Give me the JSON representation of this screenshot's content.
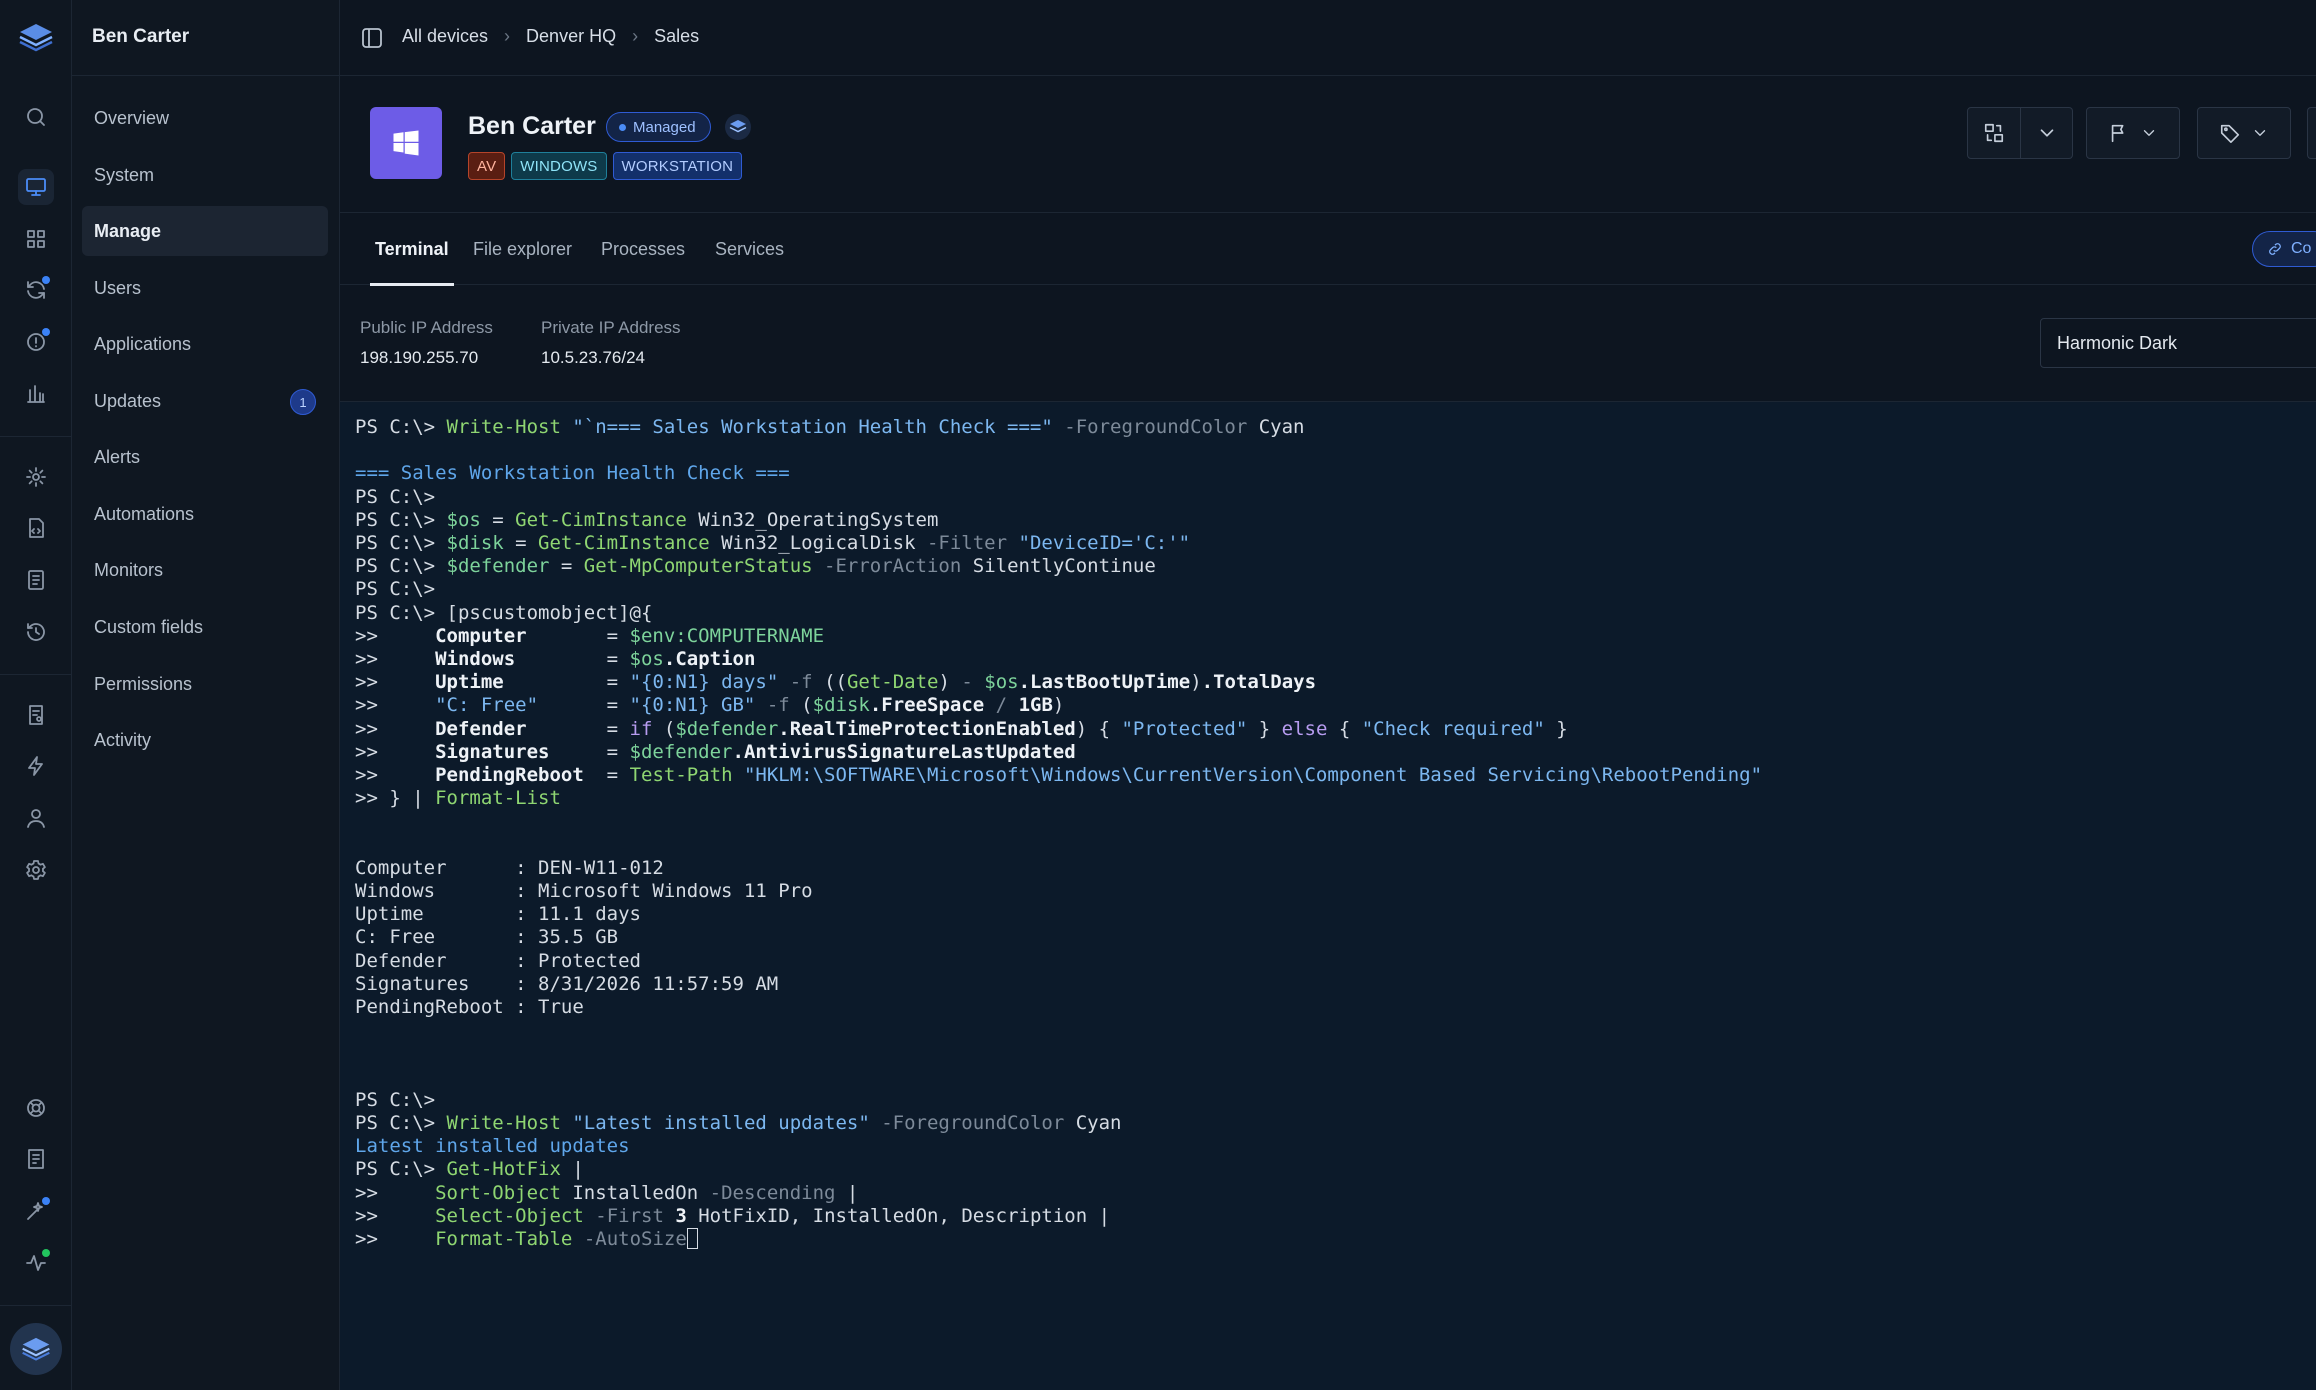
{
  "sidebar": {
    "user_name": "Ben Carter",
    "items": [
      {
        "label": "Overview",
        "badge": ""
      },
      {
        "label": "System",
        "badge": ""
      },
      {
        "label": "Manage",
        "badge": ""
      },
      {
        "label": "Users",
        "badge": ""
      },
      {
        "label": "Applications",
        "badge": ""
      },
      {
        "label": "Updates",
        "badge": "1"
      },
      {
        "label": "Alerts",
        "badge": ""
      },
      {
        "label": "Automations",
        "badge": ""
      },
      {
        "label": "Monitors",
        "badge": ""
      },
      {
        "label": "Custom fields",
        "badge": ""
      },
      {
        "label": "Permissions",
        "badge": ""
      },
      {
        "label": "Activity",
        "badge": ""
      }
    ],
    "active_item": "Manage"
  },
  "rail": {
    "icons": [
      "search-icon",
      "devices-icon",
      "apps-grid-icon",
      "sync-icon",
      "alert-icon",
      "reports-icon",
      "settings-cog-icon",
      "script-icon",
      "document-icon",
      "history-icon",
      "policy-icon",
      "automation-icon",
      "user-icon",
      "settings-icon",
      "support-icon",
      "notes-icon",
      "ai-sparkle-icon",
      "activity-icon"
    ]
  },
  "breadcrumb": {
    "items": [
      "All devices",
      "Denver HQ",
      "Sales"
    ]
  },
  "device": {
    "name": "Ben Carter",
    "status": "Managed",
    "tags": [
      "AV",
      "WINDOWS",
      "WORKSTATION"
    ],
    "os_icon": "windows-icon"
  },
  "tabs": {
    "items": [
      "Terminal",
      "File explorer",
      "Processes",
      "Services"
    ],
    "active": "Terminal",
    "connect_label": "Co"
  },
  "network": {
    "public_label": "Public IP Address",
    "public_value": "198.190.255.70",
    "private_label": "Private IP Address",
    "private_value": "10.5.23.76/24"
  },
  "terminal": {
    "theme": "Harmonic Dark",
    "lines": [
      [
        [
          "t",
          "PS C:\\> "
        ],
        [
          "cmd",
          "Write-Host"
        ],
        [
          "t",
          " "
        ],
        [
          "str",
          "\"`n=== Sales Workstation Health Check ===\""
        ],
        [
          "t",
          " "
        ],
        [
          "param",
          "-ForegroundColor"
        ],
        [
          "t",
          " Cyan"
        ]
      ],
      [],
      [
        [
          "cyan",
          "=== Sales Workstation Health Check ==="
        ]
      ],
      [
        [
          "t",
          "PS C:\\>"
        ]
      ],
      [
        [
          "t",
          "PS C:\\> "
        ],
        [
          "var",
          "$os"
        ],
        [
          "t",
          " = "
        ],
        [
          "cmd",
          "Get-CimInstance"
        ],
        [
          "t",
          " Win32_OperatingSystem"
        ]
      ],
      [
        [
          "t",
          "PS C:\\> "
        ],
        [
          "var",
          "$disk"
        ],
        [
          "t",
          " = "
        ],
        [
          "cmd",
          "Get-CimInstance"
        ],
        [
          "t",
          " Win32_LogicalDisk "
        ],
        [
          "param",
          "-Filter"
        ],
        [
          "t",
          " "
        ],
        [
          "str",
          "\"DeviceID='C:'\""
        ]
      ],
      [
        [
          "t",
          "PS C:\\> "
        ],
        [
          "var",
          "$defender"
        ],
        [
          "t",
          " = "
        ],
        [
          "cmd",
          "Get-MpComputerStatus"
        ],
        [
          "t",
          " "
        ],
        [
          "param",
          "-ErrorAction"
        ],
        [
          "t",
          " SilentlyContinue"
        ]
      ],
      [
        [
          "t",
          "PS C:\\>"
        ]
      ],
      [
        [
          "t",
          "PS C:\\> [pscustomobject]@{"
        ]
      ],
      [
        [
          "t",
          ">>     "
        ],
        [
          "b",
          "Computer"
        ],
        [
          "t",
          "       = "
        ],
        [
          "var",
          "$env:COMPUTERNAME"
        ]
      ],
      [
        [
          "t",
          ">>     "
        ],
        [
          "b",
          "Windows"
        ],
        [
          "t",
          "        = "
        ],
        [
          "var",
          "$os"
        ],
        [
          "b",
          ".Caption"
        ]
      ],
      [
        [
          "t",
          ">>     "
        ],
        [
          "b",
          "Uptime"
        ],
        [
          "t",
          "         = "
        ],
        [
          "str",
          "\"{0:N1} days\""
        ],
        [
          "t",
          " "
        ],
        [
          "param",
          "-f"
        ],
        [
          "t",
          " (("
        ],
        [
          "cmd",
          "Get-Date"
        ],
        [
          "t",
          ") "
        ],
        [
          "param",
          "-"
        ],
        [
          "t",
          " "
        ],
        [
          "var",
          "$os"
        ],
        [
          "b",
          ".LastBootUpTime"
        ],
        [
          "t",
          ")"
        ],
        [
          "b",
          ".TotalDays"
        ]
      ],
      [
        [
          "t",
          ">>     "
        ],
        [
          "str",
          "\"C: Free\""
        ],
        [
          "t",
          "      = "
        ],
        [
          "str",
          "\"{0:N1} GB\""
        ],
        [
          "t",
          " "
        ],
        [
          "param",
          "-f"
        ],
        [
          "t",
          " ("
        ],
        [
          "var",
          "$disk"
        ],
        [
          "b",
          ".FreeSpace"
        ],
        [
          "t",
          " "
        ],
        [
          "param",
          "/"
        ],
        [
          "t",
          " "
        ],
        [
          "b",
          "1GB"
        ],
        [
          "t",
          ")"
        ]
      ],
      [
        [
          "t",
          ">>     "
        ],
        [
          "b",
          "Defender"
        ],
        [
          "t",
          "       = "
        ],
        [
          "kw",
          "if"
        ],
        [
          "t",
          " ("
        ],
        [
          "var",
          "$defender"
        ],
        [
          "b",
          ".RealTimeProtectionEnabled"
        ],
        [
          "t",
          ") { "
        ],
        [
          "str",
          "\"Protected\""
        ],
        [
          "t",
          " } "
        ],
        [
          "kw",
          "else"
        ],
        [
          "t",
          " { "
        ],
        [
          "str",
          "\"Check required\""
        ],
        [
          "t",
          " }"
        ]
      ],
      [
        [
          "t",
          ">>     "
        ],
        [
          "b",
          "Signatures"
        ],
        [
          "t",
          "     = "
        ],
        [
          "var",
          "$defender"
        ],
        [
          "b",
          ".AntivirusSignatureLastUpdated"
        ]
      ],
      [
        [
          "t",
          ">>     "
        ],
        [
          "b",
          "PendingReboot"
        ],
        [
          "t",
          "  = "
        ],
        [
          "cmd",
          "Test-Path"
        ],
        [
          "t",
          " "
        ],
        [
          "str",
          "\"HKLM:\\SOFTWARE\\Microsoft\\Windows\\CurrentVersion\\Component Based Servicing\\RebootPending\""
        ]
      ],
      [
        [
          "t",
          ">> } | "
        ],
        [
          "cmd",
          "Format-List"
        ]
      ],
      [],
      [],
      [
        [
          "t",
          "Computer      : DEN-W11-012"
        ]
      ],
      [
        [
          "t",
          "Windows       : Microsoft Windows 11 Pro"
        ]
      ],
      [
        [
          "t",
          "Uptime        : 11.1 days"
        ]
      ],
      [
        [
          "t",
          "C: Free       : 35.5 GB"
        ]
      ],
      [
        [
          "t",
          "Defender      : Protected"
        ]
      ],
      [
        [
          "t",
          "Signatures    : 8/31/2026 11:57:59 AM"
        ]
      ],
      [
        [
          "t",
          "PendingReboot : True"
        ]
      ],
      [],
      [],
      [],
      [
        [
          "t",
          "PS C:\\>"
        ]
      ],
      [
        [
          "t",
          "PS C:\\> "
        ],
        [
          "cmd",
          "Write-Host"
        ],
        [
          "t",
          " "
        ],
        [
          "str",
          "\"Latest installed updates\""
        ],
        [
          "t",
          " "
        ],
        [
          "param",
          "-ForegroundColor"
        ],
        [
          "t",
          " Cyan"
        ]
      ],
      [
        [
          "cyan",
          "Latest installed updates"
        ]
      ],
      [
        [
          "t",
          "PS C:\\> "
        ],
        [
          "cmd",
          "Get-HotFix"
        ],
        [
          "t",
          " |"
        ]
      ],
      [
        [
          "t",
          ">>     "
        ],
        [
          "cmd",
          "Sort-Object"
        ],
        [
          "t",
          " InstalledOn "
        ],
        [
          "param",
          "-Descending"
        ],
        [
          "t",
          " |"
        ]
      ],
      [
        [
          "t",
          ">>     "
        ],
        [
          "cmd",
          "Select-Object"
        ],
        [
          "t",
          " "
        ],
        [
          "param",
          "-First"
        ],
        [
          "t",
          " "
        ],
        [
          "b",
          "3"
        ],
        [
          "t",
          " HotFixID, InstalledOn, Description |"
        ]
      ],
      [
        [
          "t",
          ">>     "
        ],
        [
          "cmd",
          "Format-Table"
        ],
        [
          "t",
          " "
        ],
        [
          "param",
          "-AutoSize"
        ],
        [
          "cursor",
          ""
        ]
      ]
    ]
  }
}
